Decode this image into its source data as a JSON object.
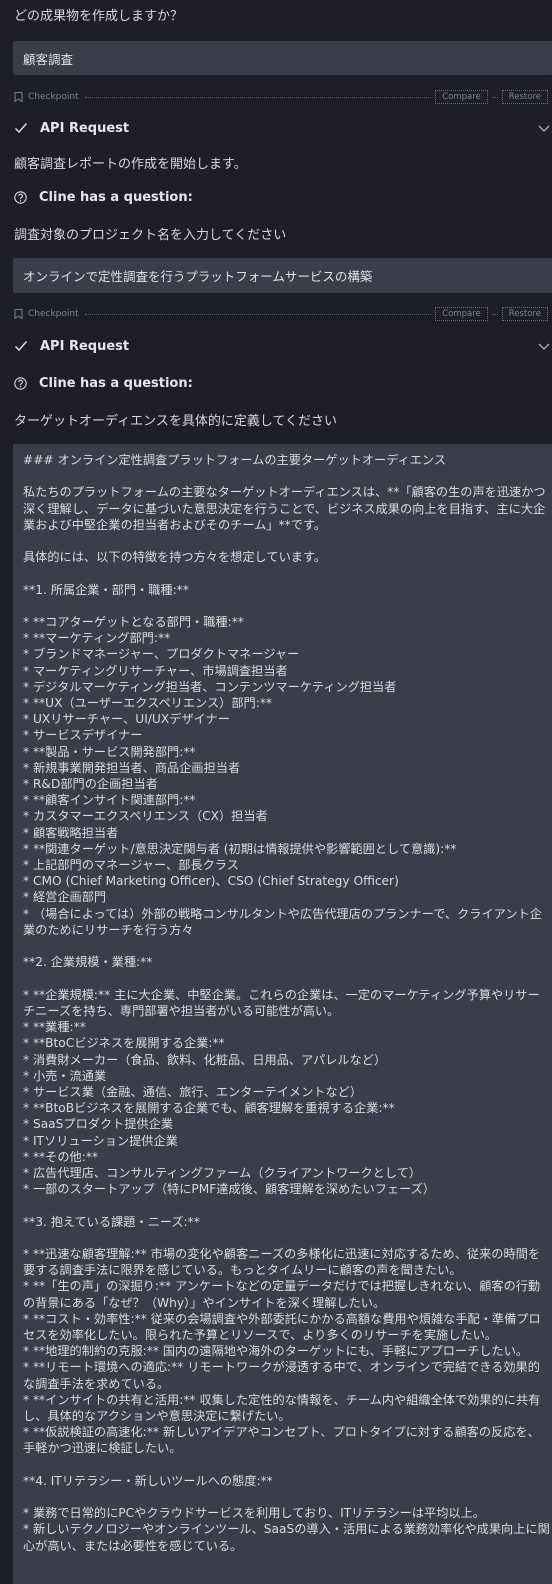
{
  "conversation": {
    "q1_text": "どの成果物を作成しますか？",
    "a1_text": "顧客調査",
    "checkpoint": {
      "label": "Checkpoint",
      "compare": "Compare",
      "restore": "Restore"
    },
    "api_request_label": "API Request",
    "status_text": "顧客調査レポートの作成を開始します。",
    "question_label": "Cline has a question:",
    "q2_text": "調査対象のプロジェクト名を入力してください",
    "a2_text": "オンラインで定性調査を行うプラットフォームサービスの構築",
    "q3_text": "ターゲットオーディエンスを具体的に定義してください"
  },
  "answer_lines": [
    "### オンライン定性調査プラットフォームの主要ターゲットオーディエンス",
    "",
    "私たちのプラットフォームの主要なターゲットオーディエンスは、**「顧客の生の声を迅速かつ",
    "深く理解し、データに基づいた意思決定を行うことで、ビジネス成果の向上を目指す、主に大企",
    "業および中堅企業の担当者およびそのチーム」**です。",
    "",
    "具体的には、以下の特徴を持つ方々を想定しています。",
    "",
    "**1. 所属企業・部門・職種:**",
    "",
    "* **コアターゲットとなる部門・職種:**",
    "* **マーケティング部門:**",
    "* ブランドマネージャー、プロダクトマネージャー",
    "* マーケティングリサーチャー、市場調査担当者",
    "* デジタルマーケティング担当者、コンテンツマーケティング担当者",
    "* **UX（ユーザーエクスペリエンス）部門:**",
    "* UXリサーチャー、UI/UXデザイナー",
    "* サービスデザイナー",
    "* **製品・サービス開発部門:**",
    "* 新規事業開発担当者、商品企画担当者",
    "* R&D部門の企画担当者",
    "* **顧客インサイト関連部門:**",
    "* カスタマーエクスペリエンス（CX）担当者",
    "* 顧客戦略担当者",
    "* **関連ターゲット/意思決定関与者 (初期は情報提供や影響範囲として意識):**",
    "* 上記部門のマネージャー、部長クラス",
    "* CMO (Chief Marketing Officer)、CSO (Chief Strategy Officer)",
    "* 経営企画部門",
    "* （場合によっては）外部の戦略コンサルタントや広告代理店のプランナーで、クライアント企",
    "業のためにリサーチを行う方々",
    "",
    "**2. 企業規模・業種:**",
    "",
    "* **企業規模:** 主に大企業、中堅企業。これらの企業は、一定のマーケティング予算やリサー",
    "チニーズを持ち、専門部署や担当者がいる可能性が高い。",
    "* **業種:**",
    "* **BtoCビジネスを展開する企業:**",
    "* 消費財メーカー（食品、飲料、化粧品、日用品、アパレルなど）",
    "* 小売・流通業",
    "* サービス業（金融、通信、旅行、エンターテイメントなど）",
    "* **BtoBビジネスを展開する企業でも、顧客理解を重視する企業:**",
    "* SaaSプロダクト提供企業",
    "* ITソリューション提供企業",
    "* **その他:**",
    "* 広告代理店、コンサルティングファーム（クライアントワークとして）",
    "* 一部のスタートアップ（特にPMF達成後、顧客理解を深めたいフェーズ）",
    "",
    "**3. 抱えている課題・ニーズ:**",
    "",
    "* **迅速な顧客理解:** 市場の変化や顧客ニーズの多様化に迅速に対応するため、従来の時間を",
    "要する調査手法に限界を感じている。もっとタイムリーに顧客の声を聞きたい。",
    "* **「生の声」の深掘り:** アンケートなどの定量データだけでは把握しきれない、顧客の行動",
    "の背景にある「なぜ？（Why）」やインサイトを深く理解したい。",
    "* **コスト・効率性:** 従来の会場調査や外部委託にかかる高額な費用や煩雑な手配・準備プロ",
    "セスを効率化したい。限られた予算とリソースで、より多くのリサーチを実施したい。",
    "* **地理的制約の克服:** 国内の遠隔地や海外のターゲットにも、手軽にアプローチしたい。",
    "* **リモート環境への適応:** リモートワークが浸透する中で、オンラインで完結できる効果的",
    "な調査手法を求めている。",
    "* **インサイトの共有と活用:** 収集した定性的な情報を、チーム内や組織全体で効果的に共有",
    "し、具体的なアクションや意思決定に繋げたい。",
    "* **仮説検証の高速化:** 新しいアイデアやコンセプト、プロトタイプに対する顧客の反応を、",
    "手軽かつ迅速に検証したい。",
    "",
    "**4. ITリテラシー・新しいツールへの態度:**",
    "",
    "* 業務で日常的にPCやクラウドサービスを利用しており、ITリテラシーは平均以上。",
    "* 新しいテクノロジーやオンラインツール、SaaSの導入・活用による業務効率化や成果向上に関",
    "心が高い、または必要性を感じている。"
  ],
  "colors": {
    "background": "#1e1e2a",
    "box": "#3b3c4c",
    "text": "#d6d6dc",
    "muted": "#7f8093"
  }
}
